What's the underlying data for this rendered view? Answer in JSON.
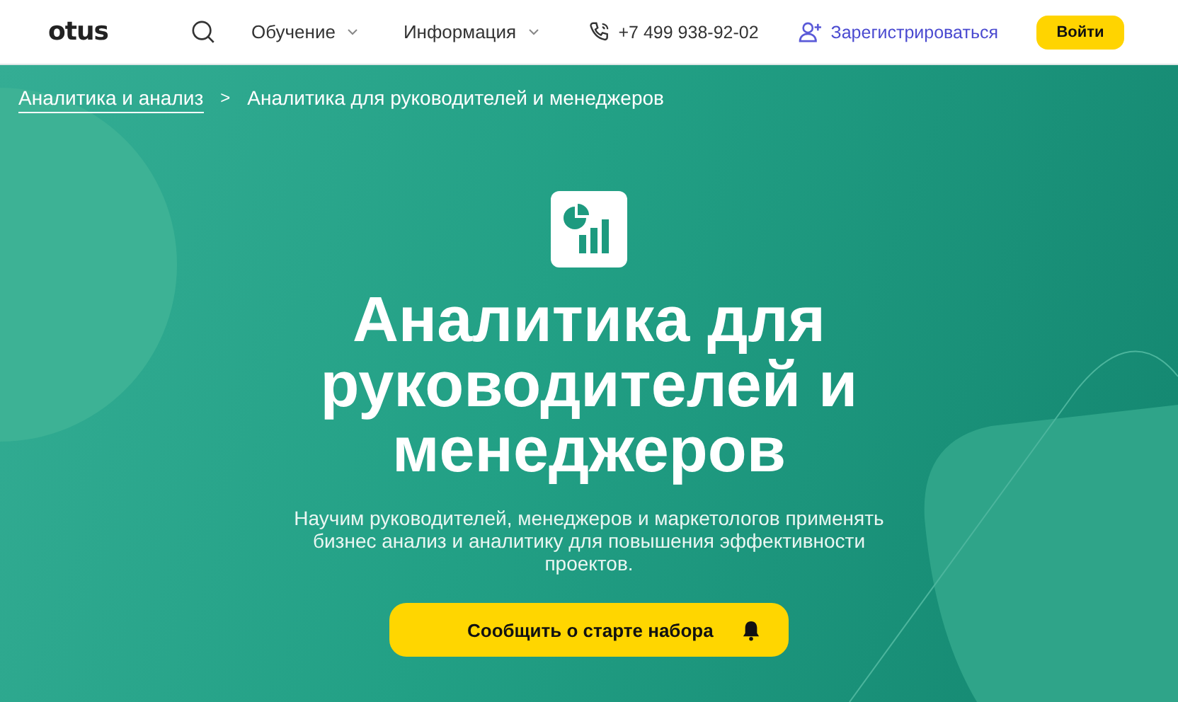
{
  "header": {
    "logo": "otus",
    "nav": [
      {
        "label": "Обучение"
      },
      {
        "label": "Информация"
      }
    ],
    "phone": "+7 499 938-92-02",
    "register": "Зарегистрироваться",
    "login": "Войти"
  },
  "breadcrumbs": [
    {
      "label": "Аналитика и анализ",
      "kind": "link"
    },
    {
      "label": "Аналитика для руководителей и менеджеров",
      "kind": "current"
    }
  ],
  "breadcrumb_separator": ">",
  "hero": {
    "title": "Аналитика для руководителей и менеджеров",
    "subtitle": "Научим руководителей, менеджеров и маркетологов применять бизнес анализ и аналитику для повышения эффективности проектов.",
    "button": "Сообщить о старте набора"
  }
}
